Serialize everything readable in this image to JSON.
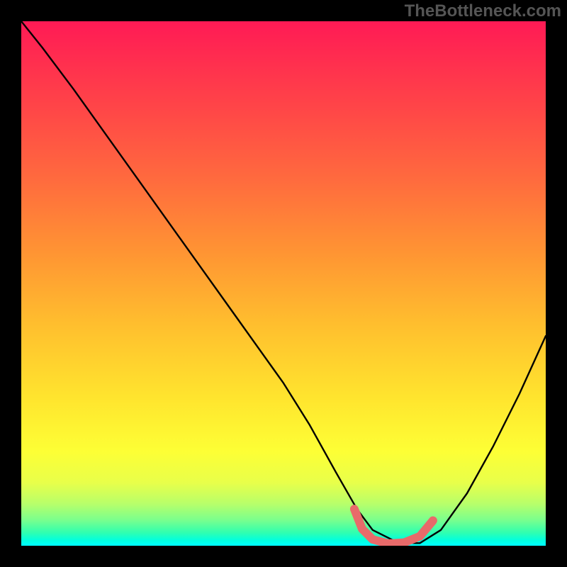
{
  "watermark": "TheBottleneck.com",
  "chart_data": {
    "type": "line",
    "title": "",
    "xlabel": "",
    "ylabel": "",
    "xlim": [
      0,
      100
    ],
    "ylim": [
      0,
      100
    ],
    "series": [
      {
        "name": "main-curve",
        "color": "#000000",
        "x": [
          0,
          4,
          10,
          20,
          30,
          40,
          50,
          55,
          60,
          64,
          67,
          72,
          76,
          80,
          85,
          90,
          95,
          100
        ],
        "y": [
          100,
          95,
          87,
          73,
          59,
          45,
          31,
          23,
          14,
          7,
          3,
          0.5,
          0.5,
          3,
          10,
          19,
          29,
          40
        ]
      },
      {
        "name": "valley-highlight",
        "color": "#e86a6a",
        "x": [
          63.5,
          65,
          67,
          70,
          73,
          76,
          78.5
        ],
        "y": [
          7,
          3.2,
          1.2,
          0.4,
          0.6,
          1.8,
          4.8
        ]
      }
    ],
    "background_gradient": {
      "top": "#ff1a55",
      "mid": "#ffe52e",
      "bottom": "#00ffe0"
    }
  }
}
